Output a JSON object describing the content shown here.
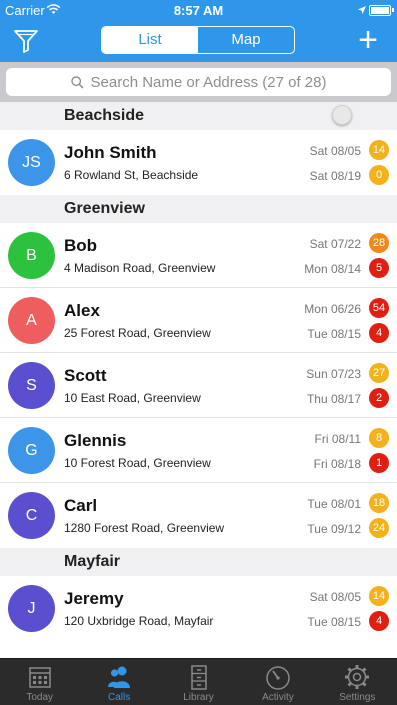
{
  "status_bar": {
    "carrier": "Carrier",
    "time": "8:57 AM"
  },
  "nav": {
    "tabs": [
      "List",
      "Map"
    ],
    "active": "List",
    "add_label": "+"
  },
  "search": {
    "placeholder": "Search Name or Address (27 of 28)"
  },
  "colors": {
    "brand": "#2f97ea",
    "badge_orange": "#f5b11b",
    "badge_red": "#e01e12"
  },
  "sections": [
    {
      "title": "Beachside",
      "rows": [
        {
          "initials": "JS",
          "avatar_color": "#3d95e9",
          "name": "John Smith",
          "address": "6 Rowland St, Beachside",
          "date1": "Sat 08/05",
          "badge1": "14",
          "badge1_color": "#f5b11b",
          "date2": "Sat 08/19",
          "badge2": "0",
          "badge2_color": "#f5b11b"
        }
      ]
    },
    {
      "title": "Greenview",
      "rows": [
        {
          "initials": "B",
          "avatar_color": "#2cc23d",
          "name": "Bob",
          "address": "4 Madison Road, Greenview",
          "date1": "Sat 07/22",
          "badge1": "28",
          "badge1_color": "#f0881a",
          "date2": "Mon 08/14",
          "badge2": "5",
          "badge2_color": "#e01e12"
        },
        {
          "initials": "A",
          "avatar_color": "#ef5e5e",
          "name": "Alex",
          "address": "25 Forest Road, Greenview",
          "date1": "Mon 06/26",
          "badge1": "54",
          "badge1_color": "#e01e12",
          "date2": "Tue 08/15",
          "badge2": "4",
          "badge2_color": "#e01e12"
        },
        {
          "initials": "S",
          "avatar_color": "#5a4fcf",
          "name": "Scott",
          "address": "10 East Road, Greenview",
          "date1": "Sun 07/23",
          "badge1": "27",
          "badge1_color": "#f5b11b",
          "date2": "Thu 08/17",
          "badge2": "2",
          "badge2_color": "#e01e12"
        },
        {
          "initials": "G",
          "avatar_color": "#3d95e9",
          "name": "Glennis",
          "address": "10 Forest Road, Greenview",
          "date1": "Fri 08/11",
          "badge1": "8",
          "badge1_color": "#f5b11b",
          "date2": "Fri 08/18",
          "badge2": "1",
          "badge2_color": "#e01e12"
        },
        {
          "initials": "C",
          "avatar_color": "#5a4fcf",
          "name": "Carl",
          "address": "1280 Forest Road, Greenview",
          "date1": "Tue 08/01",
          "badge1": "18",
          "badge1_color": "#f5b11b",
          "date2": "Tue 09/12",
          "badge2": "24",
          "badge2_color": "#f5b11b"
        }
      ]
    },
    {
      "title": "Mayfair",
      "rows": [
        {
          "initials": "J",
          "avatar_color": "#5a4fcf",
          "name": "Jeremy",
          "address": "120 Uxbridge Road, Mayfair",
          "date1": "Sat 08/05",
          "badge1": "14",
          "badge1_color": "#f5b11b",
          "date2": "Tue 08/15",
          "badge2": "4",
          "badge2_color": "#e01e12"
        }
      ]
    }
  ],
  "tab_bar": [
    {
      "label": "Today",
      "icon": "calendar-icon",
      "active": false
    },
    {
      "label": "Calls",
      "icon": "people-icon",
      "active": true
    },
    {
      "label": "Library",
      "icon": "cabinet-icon",
      "active": false
    },
    {
      "label": "Activity",
      "icon": "gauge-icon",
      "active": false
    },
    {
      "label": "Settings",
      "icon": "gear-icon",
      "active": false
    }
  ]
}
